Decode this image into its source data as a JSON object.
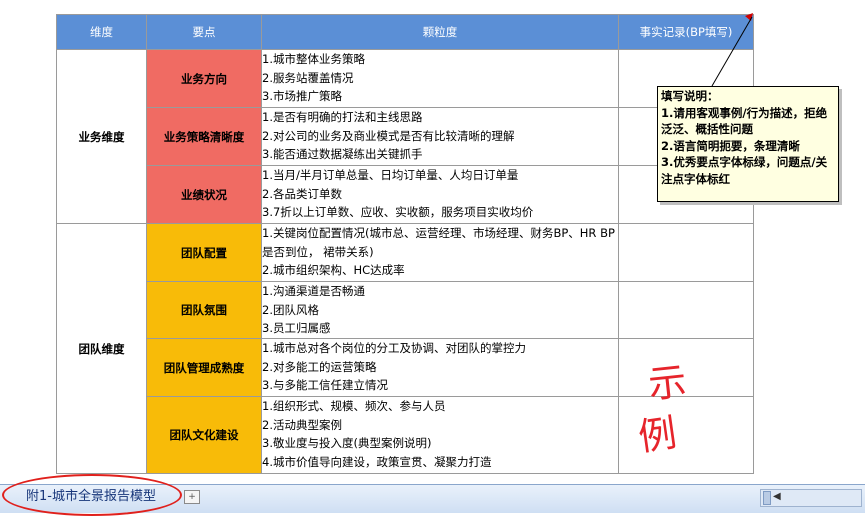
{
  "table": {
    "headers": [
      "维度",
      "要点",
      "颗粒度",
      "事实记录(BP填写)"
    ],
    "dimensions": {
      "business": "业务维度",
      "team": "团队维度"
    },
    "rows": [
      {
        "point": "业务方向",
        "details": [
          "1.城市整体业务策略",
          "2.服务站覆盖情况",
          "3.市场推广策略"
        ]
      },
      {
        "point": "业务策略清晰度",
        "details": [
          "1.是否有明确的打法和主线思路",
          "2.对公司的业务及商业模式是否有比较清晰的理解",
          "3.能否通过数据凝练出关键抓手"
        ]
      },
      {
        "point": "业绩状况",
        "details": [
          "1.当月/半月订单总量、日均订单量、人均日订单量",
          "2.各品类订单数",
          "3.7折以上订单数、应收、实收额，服务项目实收均价"
        ]
      },
      {
        "point": "团队配置",
        "details": [
          "1.关键岗位配置情况(城市总、运营经理、市场经理、财务BP、HR BP是否到位， 裙带关系)",
          "2.城市组织架构、HC达成率"
        ]
      },
      {
        "point": "团队氛围",
        "details": [
          "1.沟通渠道是否畅通",
          "2.团队风格",
          "3.员工归属感"
        ]
      },
      {
        "point": "团队管理成熟度",
        "details": [
          "1.城市总对各个岗位的分工及协调、对团队的掌控力",
          "2.对多能工的运营策略",
          "3.与多能工信任建立情况"
        ]
      },
      {
        "point": "团队文化建设",
        "details": [
          "1.组织形式、规模、频次、参与人员",
          "2.活动典型案例",
          "3.敬业度与投入度(典型案例说明)",
          "4.城市价值导向建设，政策宣贯、凝聚力打造"
        ]
      }
    ]
  },
  "comment": {
    "title": "填写说明：",
    "lines": [
      "1.请用客观事例/行为描述，拒绝泛泛、概括性问题",
      "2.语言简明扼要，条理清晰",
      "3.优秀要点字体标绿，问题点/关注点字体标红"
    ]
  },
  "annotation": {
    "char1": "示",
    "char2": "例"
  },
  "tabbar": {
    "sheet_tab": "附1-城市全景报告模型"
  },
  "colors": {
    "header": "#5b8fd6",
    "business_point": "#f06b63",
    "team_point": "#f8bb08",
    "annotation": "#e6242b",
    "comment_bg": "#ffffe1"
  }
}
